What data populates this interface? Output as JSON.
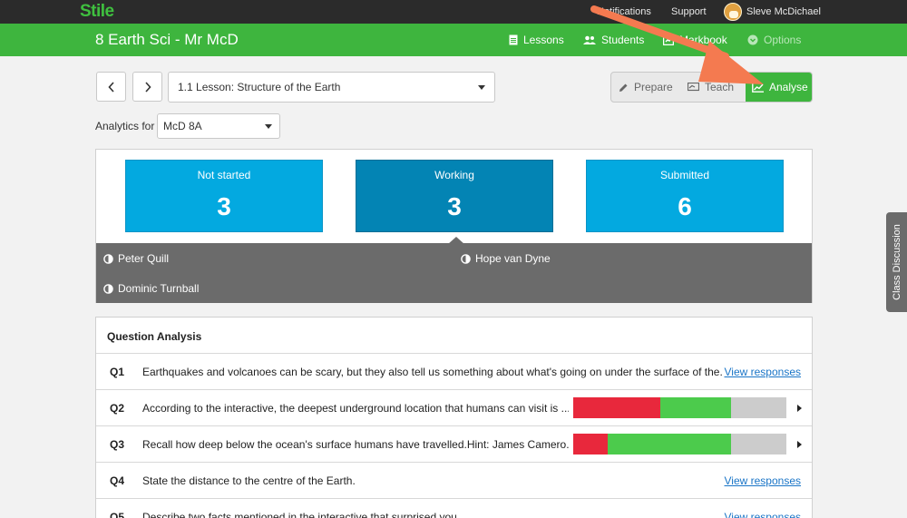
{
  "topbar": {
    "logo": "Stile",
    "notifications_label": "Notifications",
    "support_label": "Support",
    "user_name": "Sleve McDichael"
  },
  "classbar": {
    "class_title": "8 Earth Sci - Mr McD",
    "nav": {
      "lessons": "Lessons",
      "students": "Students",
      "markbook": "Markbook",
      "options": "Options"
    }
  },
  "lesson_nav": {
    "prev_icon": "chevron-left-icon",
    "next_icon": "chevron-right-icon",
    "lesson_select_value": "1.1 Lesson: Structure of the Earth"
  },
  "modes": {
    "prepare": "Prepare",
    "teach": "Teach",
    "analyse": "Analyse",
    "active": "analyse"
  },
  "analytics": {
    "label": "Analytics for",
    "group_value": "McD 8A"
  },
  "status": {
    "cards": [
      {
        "label": "Not started",
        "count": "3"
      },
      {
        "label": "Working",
        "count": "3"
      },
      {
        "label": "Submitted",
        "count": "6"
      }
    ],
    "selected": "Working",
    "students": [
      "Peter Quill",
      "Hope van Dyne",
      "Dominic Turnball"
    ]
  },
  "question_analysis": {
    "title": "Question Analysis",
    "view_label": "View responses",
    "questions": [
      {
        "num": "Q1",
        "text": "Earthquakes and volcanoes can be scary, but they also tell us something about what's going on under the surface of the..."
      },
      {
        "num": "Q2",
        "text": "According to the interactive, the deepest underground location that humans can visit is ...",
        "incorrect": 0.41,
        "correct": 0.33,
        "unanswered": 0.26
      },
      {
        "num": "Q3",
        "text": "Recall how deep below the ocean's surface humans have travelled.Hint: James Camero...",
        "incorrect": 0.16,
        "correct": 0.58,
        "unanswered": 0.26
      },
      {
        "num": "Q4",
        "text": "State the distance to the centre of the Earth."
      },
      {
        "num": "Q5",
        "text": "Describe two facts mentioned in the interactive that surprised you."
      }
    ]
  },
  "side_tab": {
    "label": "Class Discussion"
  },
  "colors": {
    "brand_green": "#3eb53e",
    "card_blue": "#03a9e0",
    "card_blue_selected": "#0384b4",
    "bar_incorrect": "#e8283c",
    "bar_correct": "#4ccb4c",
    "bar_unanswered": "#cccccc",
    "annotation_arrow": "#f47a50"
  }
}
